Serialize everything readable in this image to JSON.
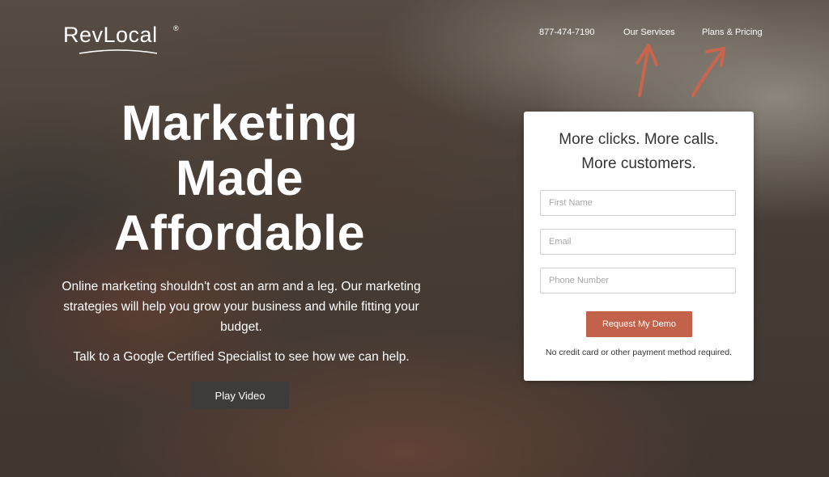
{
  "brand": {
    "name": "RevLocal",
    "registered": "®"
  },
  "nav": {
    "phone": "877-474-7190",
    "services": "Our Services",
    "pricing": "Plans & Pricing"
  },
  "hero": {
    "title_lines": [
      "Marketing",
      "Made",
      "Affordable"
    ],
    "body": "Online marketing shouldn't cost an arm and a leg. Our marketing strategies will help you grow your business and while fitting your budget.",
    "cta_text": "Talk to a Google Certified Specialist to see how we can help.",
    "play_button": "Play Video"
  },
  "form": {
    "headline_1": "More clicks. More calls.",
    "headline_2": "More customers.",
    "first_name_placeholder": "First Name",
    "email_placeholder": "Email",
    "phone_placeholder": "Phone Number",
    "submit_label": "Request My Demo",
    "disclaimer": "No credit card or other payment method required."
  },
  "colors": {
    "accent": "#c3624b",
    "annotation_arrow": "#c8654c",
    "play_button_bg": "#3e3c3a",
    "card_bg": "#ffffff"
  }
}
